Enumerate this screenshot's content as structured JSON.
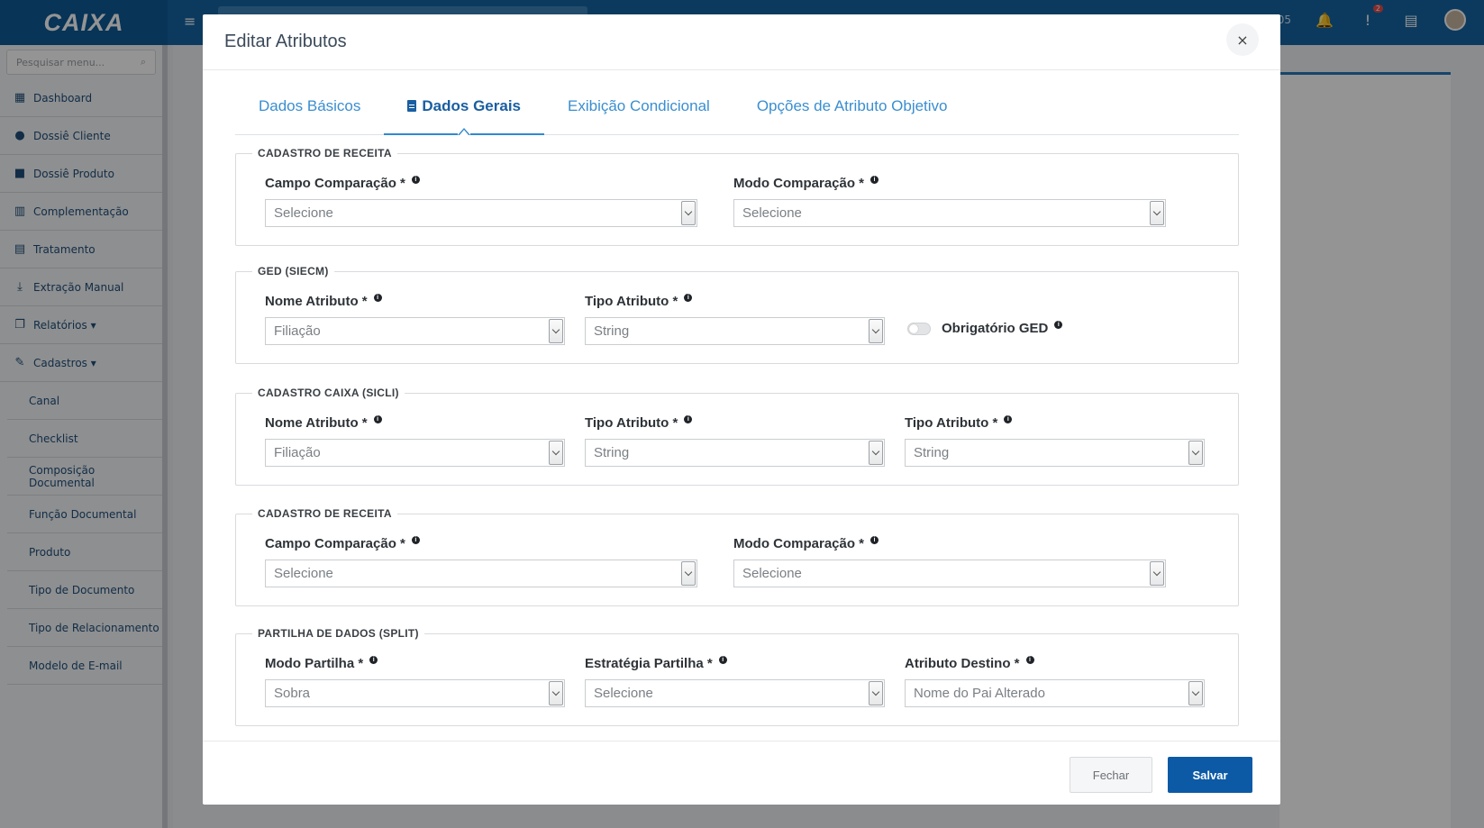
{
  "app": {
    "brand": "CAIXA",
    "top_counter": "05",
    "alert_badge": "2",
    "sidebar_search_placeholder": "Pesquisar menu...",
    "sidebar": [
      {
        "label": "Dashboard",
        "icon": "dashboard-icon"
      },
      {
        "label": "Dossiê Cliente",
        "icon": "user-icon"
      },
      {
        "label": "Dossiê Produto",
        "icon": "briefcase-icon"
      },
      {
        "label": "Complementação",
        "icon": "chart-icon"
      },
      {
        "label": "Tratamento",
        "icon": "document-icon"
      },
      {
        "label": "Extração Manual",
        "icon": "download-icon"
      },
      {
        "label": "Relatórios ▾",
        "icon": "reports-icon"
      },
      {
        "label": "Cadastros ▾",
        "icon": "register-icon"
      }
    ],
    "sidebar_sub": [
      "Canal",
      "Checklist",
      "Composição Documental",
      "Função Documental",
      "Produto",
      "Tipo de Documento",
      "Tipo de Relacionamento",
      "Modelo de E-mail"
    ]
  },
  "modal": {
    "title": "Editar Atributos",
    "close": "×",
    "tabs": [
      "Dados Básicos",
      "Dados Gerais",
      "Exibição Condicional",
      "Opções de Atributo Objetivo"
    ],
    "sections": {
      "receita1": {
        "legend": "CADASTRO DE RECEITA",
        "campo_label": "Campo Comparação *",
        "campo_value": "Selecione",
        "modo_label": "Modo Comparação *",
        "modo_value": "Selecione"
      },
      "ged": {
        "legend": "GED (SIECM)",
        "nome_label": "Nome Atributo *",
        "nome_value": "Filiação",
        "tipo_label": "Tipo Atributo *",
        "tipo_value": "String",
        "obrigatorio_label": "Obrigatório GED"
      },
      "sicli": {
        "legend": "CADASTRO CAIXA (SICLI)",
        "nome_label": "Nome Atributo *",
        "nome_value": "Filiação",
        "tipo1_label": "Tipo Atributo *",
        "tipo1_value": "String",
        "tipo2_label": "Tipo Atributo *",
        "tipo2_value": "String"
      },
      "receita2": {
        "legend": "CADASTRO DE RECEITA",
        "campo_label": "Campo Comparação *",
        "campo_value": "Selecione",
        "modo_label": "Modo Comparação *",
        "modo_value": "Selecione"
      },
      "split": {
        "legend": "PARTILHA DE DADOS (SPLIT)",
        "modo_label": "Modo Partilha *",
        "modo_value": "Sobra",
        "estrategia_label": "Estratégia Partilha *",
        "estrategia_value": "Selecione",
        "destino_label": "Atributo Destino *",
        "destino_value": "Nome do Pai Alterado"
      }
    },
    "footer": {
      "close_label": "Fechar",
      "save_label": "Salvar"
    }
  }
}
